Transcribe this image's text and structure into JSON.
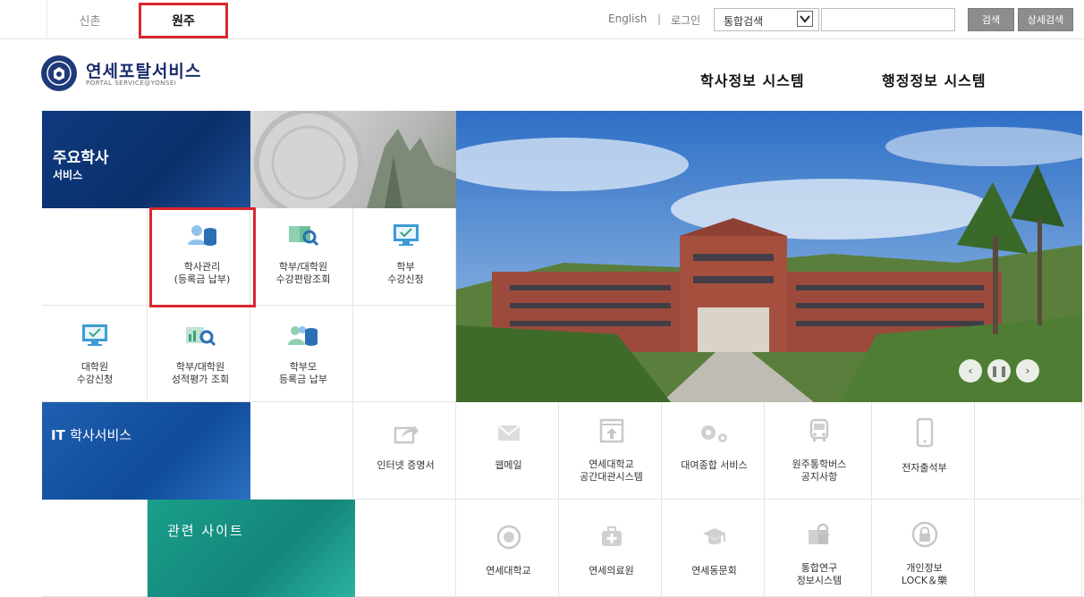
{
  "topbar": {
    "campus_sinchon": "신촌",
    "campus_wonju": "원주",
    "english": "English",
    "divider": "|",
    "login": "로그인",
    "search_scope": "통합검색",
    "search_button": "검색",
    "advanced_search_button": "상세검색"
  },
  "header": {
    "logo_title": "연세포탈서비스",
    "logo_sub": "PORTAL SERVICE@YONSEI",
    "nav_academic": "학사정보 시스템",
    "nav_admin": "행정정보 시스템"
  },
  "academic": {
    "title": "주요학사",
    "subtitle": "서비스",
    "tiles": [
      {
        "line1": "학사관리",
        "line2": "(등록금 납부)"
      },
      {
        "line1": "학부/대학원",
        "line2": "수강편람조회"
      },
      {
        "line1": "학부",
        "line2": "수강신청"
      },
      {
        "line1": "대학원",
        "line2": "수강신청"
      },
      {
        "line1": "학부/대학원",
        "line2": "성적평가 조회"
      },
      {
        "line1": "학부모",
        "line2": "등록금 납부"
      }
    ]
  },
  "it_services": {
    "title_en": "IT",
    "title": "학사서비스",
    "tiles": [
      {
        "line1": "인터넷 증명서",
        "line2": ""
      },
      {
        "line1": "웹메일",
        "line2": ""
      },
      {
        "line1": "연세대학교",
        "line2": "공간대관시스템"
      },
      {
        "line1": "대여종합 서비스",
        "line2": ""
      },
      {
        "line1": "원주통학버스",
        "line2": "공지사항"
      },
      {
        "line1": "전자출석부",
        "line2": ""
      }
    ]
  },
  "related": {
    "title": "관련 사이트",
    "tiles": [
      {
        "line1": "연세대학교",
        "line2": ""
      },
      {
        "line1": "연세의료원",
        "line2": ""
      },
      {
        "line1": "연세동문회",
        "line2": ""
      },
      {
        "line1": "통합연구",
        "line2": "정보시스템"
      },
      {
        "line1": "개인정보",
        "line2": "LOCK＆樂"
      }
    ]
  },
  "colors": {
    "highlight": "#d8282f",
    "navy": "#0b2f6a",
    "it_blue": "#0f4b98",
    "teal": "#13857a",
    "tile_icon_blue": "#4a9ad6",
    "tile_icon_green": "#5bbf9a"
  }
}
